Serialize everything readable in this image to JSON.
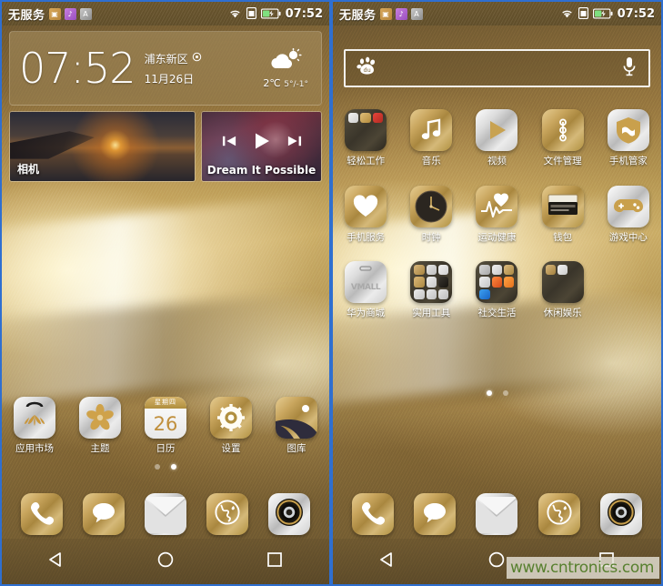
{
  "meta": {
    "watermark": "www.cntronics.com"
  },
  "colors": {
    "accent_gold": "#c9a65e",
    "wall_dark": "#6b5530",
    "wall_light": "#c9ad68",
    "frame_blue": "#2f6fd0",
    "watermark_green": "#58802f"
  },
  "status_bar": {
    "carrier": "无服务",
    "time": "07:52",
    "icons": [
      "wifi-icon",
      "signal-icon",
      "battery-icon"
    ],
    "notif_chips": [
      "notif-chip-orange",
      "notif-chip-purple",
      "notif-chip-grey"
    ]
  },
  "left_screen": {
    "clock_widget": {
      "time": "07:52",
      "location": "浦东新区",
      "date": "11月26日",
      "temperature": "2℃",
      "high_low": "5°/-1°",
      "weather_icon": "partly-cloudy-icon",
      "location_icon": "location-pin-icon"
    },
    "media": {
      "camera_label": "相机",
      "music_title": "Dream It Possible",
      "controls": [
        "previous-track-icon",
        "play-icon",
        "next-track-icon"
      ]
    },
    "apps": [
      {
        "label": "应用市场",
        "icon": "huawei-appgallery-icon",
        "material": "silver"
      },
      {
        "label": "主题",
        "icon": "themes-icon",
        "material": "silver"
      },
      {
        "label": "日历",
        "icon": "calendar-icon",
        "material": "silver",
        "cal_weekday": "星期四",
        "cal_day": "26"
      },
      {
        "label": "设置",
        "icon": "settings-gear-icon",
        "material": "gold"
      },
      {
        "label": "图库",
        "icon": "gallery-icon",
        "material": "gold"
      }
    ],
    "page_dots": {
      "count": 2,
      "active": 1
    }
  },
  "right_screen": {
    "search": {
      "engine_icon": "baidu-paw-icon",
      "placeholder": "",
      "value": "",
      "mic_icon": "microphone-icon"
    },
    "rows": [
      [
        {
          "label": "轻松工作",
          "icon": "work-folder-icon",
          "material": "folder",
          "folder_count": 3
        },
        {
          "label": "音乐",
          "icon": "music-note-icon",
          "material": "gold"
        },
        {
          "label": "视频",
          "icon": "video-play-icon",
          "material": "silver"
        },
        {
          "label": "文件管理",
          "icon": "file-manager-icon",
          "material": "gold"
        },
        {
          "label": "手机管家",
          "icon": "phone-manager-shield-icon",
          "material": "silver"
        }
      ],
      [
        {
          "label": "手机服务",
          "icon": "phone-service-heart-icon",
          "material": "gold"
        },
        {
          "label": "时钟",
          "icon": "clock-face-icon",
          "material": "gold"
        },
        {
          "label": "运动健康",
          "icon": "health-heartbeat-icon",
          "material": "gold"
        },
        {
          "label": "钱包",
          "icon": "wallet-icon",
          "material": "gold"
        },
        {
          "label": "游戏中心",
          "icon": "game-controller-icon",
          "material": "silver"
        }
      ],
      [
        {
          "label": "华为商城",
          "icon": "vmall-icon",
          "material": "silver",
          "icon_text": "VMALL"
        },
        {
          "label": "实用工具",
          "icon": "tools-folder-icon",
          "material": "folder",
          "folder_count": 9
        },
        {
          "label": "社交生活",
          "icon": "social-folder-icon",
          "material": "folder",
          "folder_count": 7
        },
        {
          "label": "休闲娱乐",
          "icon": "entertainment-folder-icon",
          "material": "folder",
          "folder_count": 2
        }
      ]
    ],
    "page_dots": {
      "count": 2,
      "active": 0
    }
  },
  "dock": [
    {
      "icon": "phone-dialer-icon",
      "material": "gold",
      "name": "dock-phone"
    },
    {
      "icon": "messages-bubble-icon",
      "material": "gold",
      "name": "dock-messages"
    },
    {
      "icon": "email-envelope-icon",
      "material": "silver",
      "name": "dock-email"
    },
    {
      "icon": "browser-globe-icon",
      "material": "gold",
      "name": "dock-browser"
    },
    {
      "icon": "camera-lens-icon",
      "material": "silver",
      "name": "dock-camera"
    }
  ],
  "nav_bar": [
    {
      "icon": "back-triangle-icon",
      "name": "nav-back"
    },
    {
      "icon": "home-circle-icon",
      "name": "nav-home"
    },
    {
      "icon": "recents-square-icon",
      "name": "nav-recents"
    }
  ]
}
